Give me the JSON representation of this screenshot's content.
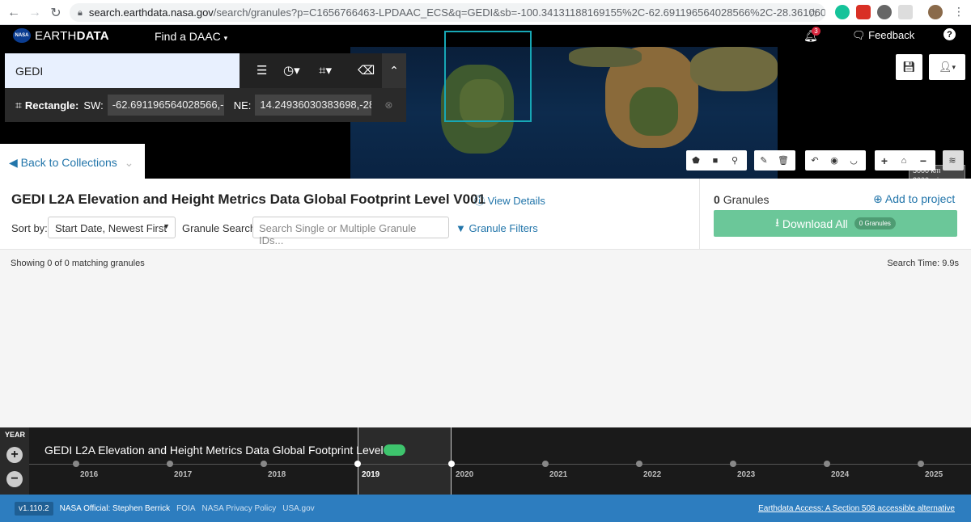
{
  "browser": {
    "url_host": "search.earthdata.nasa.gov",
    "url_path": "/search/granules?p=C1656766463-LPDAAC_ECS&q=GEDI&sb=-100.34131188169155%2C-62.691196564028566%2C-28.361060755340986%2C..."
  },
  "header": {
    "brand_light": "EARTH",
    "brand_bold": "DATA",
    "nasa": "NASA",
    "find_daac": "Find a DAAC",
    "notifications_count": "3",
    "feedback": "Feedback",
    "help": "?"
  },
  "search": {
    "query": "GEDI",
    "spatial_label": "Rectangle:",
    "sw_label": "SW:",
    "sw_value": "-62.691196564028566,-1",
    "ne_label": "NE:",
    "ne_value": "14.24936030383698,-28."
  },
  "map": {
    "scale_km": "5000 km",
    "scale_mi": "3000 mi"
  },
  "back_to_collections": "Back to Collections",
  "collection": {
    "title": "GEDI L2A Elevation and Height Metrics Data Global Footprint Level V001",
    "view_details": "View Details",
    "sort_label": "Sort by:",
    "sort_value": "Start Date, Newest First",
    "granule_search_label": "Granule Search:",
    "granule_search_placeholder": "Search Single or Multiple Granule IDs...",
    "granule_filters": "Granule Filters"
  },
  "project": {
    "granule_count": "0",
    "granules_word": "Granules",
    "add_to_project": "Add to project",
    "download_all": "Download All",
    "download_pill": "0 Granules"
  },
  "results": {
    "showing": "Showing 0 of 0 matching granules",
    "search_time": "Search Time: 9.9s"
  },
  "timeline": {
    "unit": "YEAR",
    "zoom_in": "+",
    "zoom_out": "−",
    "title": "GEDI L2A Elevation and Height Metrics Data Global Footprint Level V...",
    "years": [
      "2016",
      "2017",
      "2018",
      "2019",
      "2020",
      "2021",
      "2022",
      "2023",
      "2024",
      "2025"
    ]
  },
  "footer": {
    "version": "v1.110.2",
    "official": "NASA Official: Stephen Berrick",
    "foia": "FOIA",
    "privacy": "NASA Privacy Policy",
    "usagov": "USA.gov",
    "access508": "Earthdata Access: A Section 508 accessible alternative"
  }
}
